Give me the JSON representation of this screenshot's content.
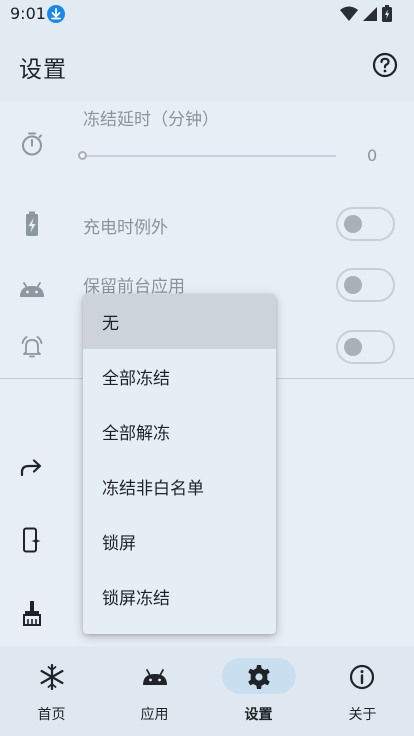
{
  "status_bar": {
    "time": "9:01"
  },
  "app_bar": {
    "title": "设置"
  },
  "settings": {
    "freeze_delay": {
      "label": "冻结延时（分钟）",
      "value": "0"
    },
    "charging_exception": {
      "label": "充电时例外",
      "enabled": false
    },
    "keep_foreground": {
      "label": "保留前台应用",
      "enabled": false
    },
    "notification_toggle": {
      "enabled": false
    }
  },
  "dropdown": {
    "options": [
      "无",
      "全部冻结",
      "全部解冻",
      "冻结非白名单",
      "锁屏",
      "锁屏冻结"
    ],
    "selected": "无"
  },
  "bottom_nav": {
    "items": [
      {
        "label": "首页",
        "icon": "snowflake-icon"
      },
      {
        "label": "应用",
        "icon": "android-icon"
      },
      {
        "label": "设置",
        "icon": "gear-icon"
      },
      {
        "label": "关于",
        "icon": "info-icon"
      }
    ],
    "active": "设置"
  },
  "colors": {
    "background": "#e7eef5",
    "nav_active_pill": "#c9dff0",
    "menu_selected": "#ccd3d9"
  }
}
